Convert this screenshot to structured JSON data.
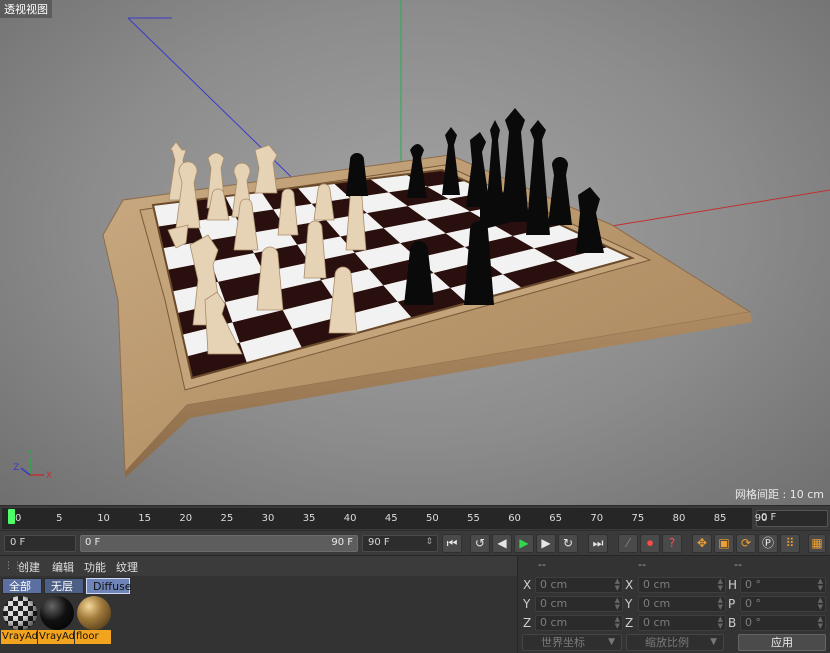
{
  "viewport": {
    "title": "透视视图",
    "grid_spacing": "网格间距 : 10 cm",
    "axis_labels": {
      "x": "X",
      "y": "Y",
      "z": "Z"
    }
  },
  "timeline": {
    "ticks": [
      "0",
      "5",
      "10",
      "15",
      "20",
      "25",
      "30",
      "35",
      "40",
      "45",
      "50",
      "55",
      "60",
      "65",
      "70",
      "75",
      "80",
      "85",
      "90"
    ],
    "end_frame": "0 F",
    "current_frame": "0 F",
    "range_start": "0 F",
    "range_end": "90 F",
    "max_frame": "90 F"
  },
  "material_manager": {
    "menu": [
      "创建",
      "编辑",
      "功能",
      "纹理"
    ],
    "tabs": [
      "全部",
      "无层",
      "Diffuse"
    ],
    "materials": [
      {
        "name": "VrayAdv",
        "style": "checker"
      },
      {
        "name": "VrayAdv",
        "style": "black"
      },
      {
        "name": "floor",
        "style": "bronze"
      }
    ]
  },
  "coordinates": {
    "headers": [
      "--",
      "--",
      "--"
    ],
    "rows": [
      {
        "axis1": "X",
        "pos": "0 cm",
        "axis2": "X",
        "size": "0 cm",
        "axis3": "H",
        "rot": "0 °"
      },
      {
        "axis1": "Y",
        "pos": "0 cm",
        "axis2": "Y",
        "size": "0 cm",
        "axis3": "P",
        "rot": "0 °"
      },
      {
        "axis1": "Z",
        "pos": "0 cm",
        "axis2": "Z",
        "size": "0 cm",
        "axis3": "B",
        "rot": "0 °"
      }
    ],
    "coord_system": "世界坐标",
    "scale_mode": "缩放比例",
    "apply_label": "应用"
  },
  "colors": {
    "accent_green": "#4cff6a",
    "material_label": "#f2a41e",
    "x_axis": "#c03030",
    "y_axis": "#2aa84a",
    "z_axis": "#3a3ac8"
  }
}
